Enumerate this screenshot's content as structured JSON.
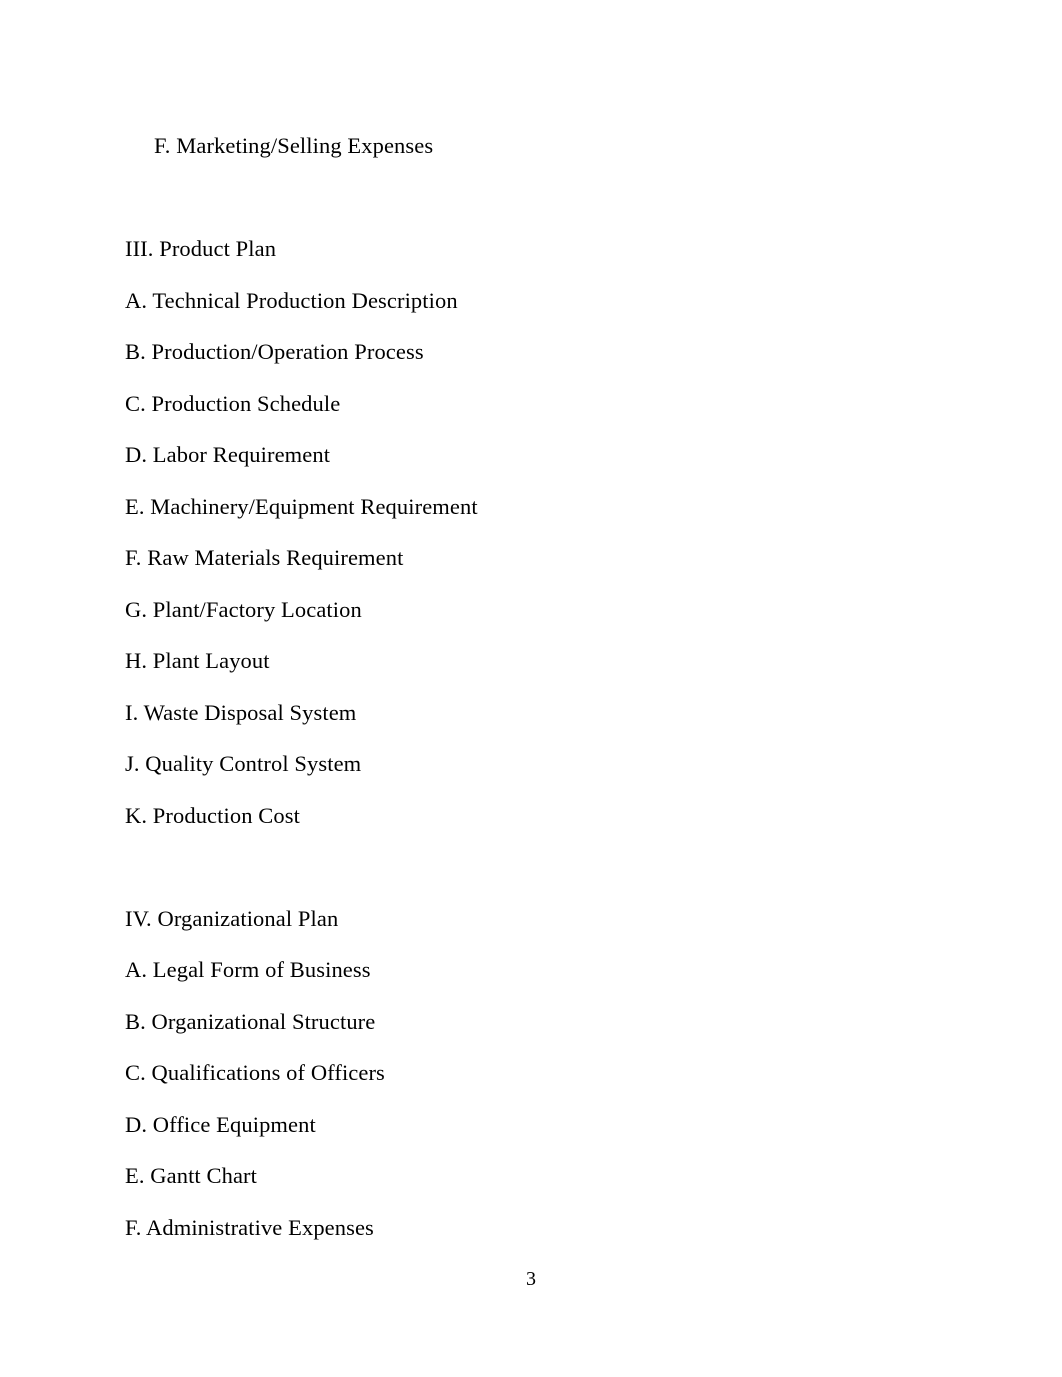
{
  "document": {
    "page_number": "3",
    "background_color": "#ffffff",
    "text_color": "#000000",
    "lines": [
      {
        "text": "F. Marketing/Selling Expenses",
        "indented": true,
        "section_gap": false
      },
      {
        "text": "III. Product Plan",
        "indented": false,
        "section_gap": true
      },
      {
        "text": "A. Technical Production Description",
        "indented": false,
        "section_gap": false
      },
      {
        "text": "B. Production/Operation Process",
        "indented": false,
        "section_gap": false
      },
      {
        "text": "C. Production Schedule",
        "indented": false,
        "section_gap": false
      },
      {
        "text": "D. Labor Requirement",
        "indented": false,
        "section_gap": false
      },
      {
        "text": "E. Machinery/Equipment Requirement",
        "indented": false,
        "section_gap": false
      },
      {
        "text": "F. Raw Materials Requirement",
        "indented": false,
        "section_gap": false
      },
      {
        "text": "G. Plant/Factory Location",
        "indented": false,
        "section_gap": false
      },
      {
        "text": "H. Plant Layout",
        "indented": false,
        "section_gap": false
      },
      {
        "text": "I. Waste Disposal System",
        "indented": false,
        "section_gap": false
      },
      {
        "text": "J. Quality Control System",
        "indented": false,
        "section_gap": false
      },
      {
        "text": "K. Production Cost",
        "indented": false,
        "section_gap": false
      },
      {
        "text": "IV. Organizational Plan",
        "indented": false,
        "section_gap": true
      },
      {
        "text": "A. Legal Form of Business",
        "indented": false,
        "section_gap": false
      },
      {
        "text": "B. Organizational Structure",
        "indented": false,
        "section_gap": false
      },
      {
        "text": "C. Qualifications of Officers",
        "indented": false,
        "section_gap": false
      },
      {
        "text": "D. Office Equipment",
        "indented": false,
        "section_gap": false
      },
      {
        "text": "E. Gantt Chart",
        "indented": false,
        "section_gap": false
      },
      {
        "text": "F. Administrative Expenses",
        "indented": false,
        "section_gap": false
      }
    ]
  }
}
